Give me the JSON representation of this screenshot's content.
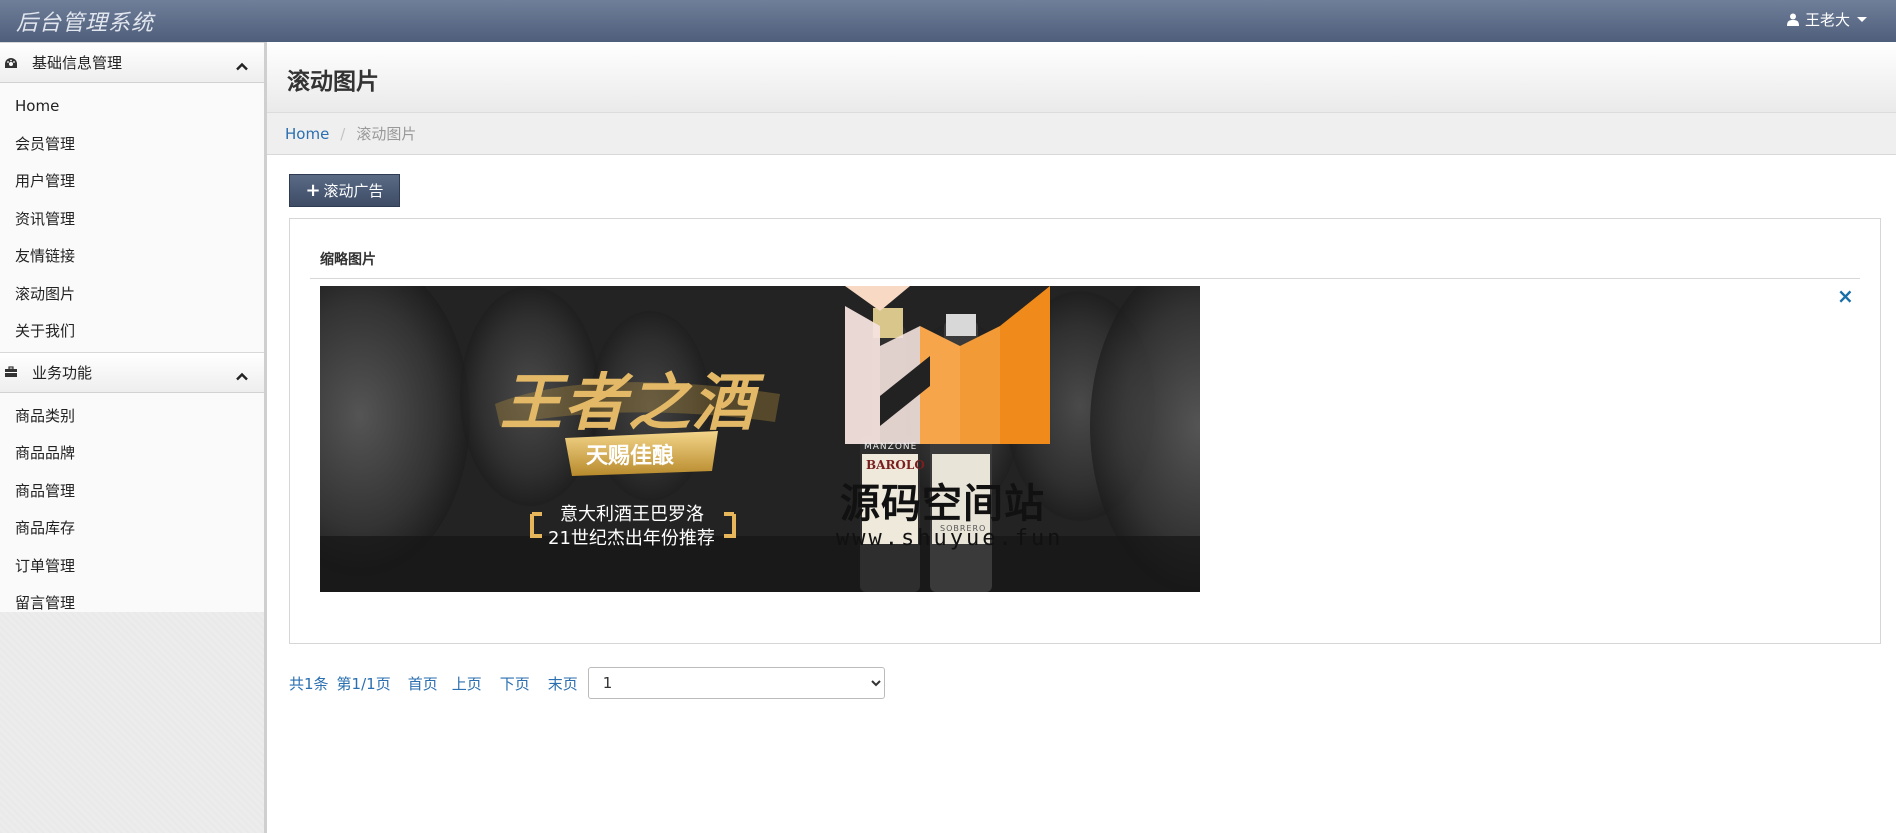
{
  "app": {
    "title": "后台管理系统"
  },
  "user": {
    "name": "王老大"
  },
  "sidebar": {
    "groups": [
      {
        "label": "基础信息管理",
        "items": [
          "Home",
          "会员管理",
          "用户管理",
          "资讯管理",
          "友情链接",
          "滚动图片",
          "关于我们"
        ]
      },
      {
        "label": "业务功能",
        "items": [
          "商品类别",
          "商品品牌",
          "商品管理",
          "商品库存",
          "订单管理",
          "留言管理"
        ]
      }
    ]
  },
  "page": {
    "title": "滚动图片"
  },
  "breadcrumb": {
    "home": "Home",
    "current": "滚动图片"
  },
  "toolbar": {
    "add_label": "滚动广告"
  },
  "table": {
    "column_header": "缩略图片",
    "delete_label": "×",
    "banner": {
      "headline": "王者之酒",
      "ribbon": "天赐佳酿",
      "line1": "意大利酒王巴罗洛",
      "line2": "21世纪杰出年份推荐",
      "bottle_label_1": "BAROLO",
      "bottle_label_2": "MANZONE",
      "bottle_label_3": "SOBRERO",
      "watermark_title": "源码空间站",
      "watermark_url": "www.shuyue.fun"
    }
  },
  "pagination": {
    "total": "共1条",
    "page_info": "第1/1页",
    "first": "首页",
    "prev": "上页",
    "next": "下页",
    "last": "末页",
    "selected_page": "1"
  },
  "colors": {
    "navbar": "#5b6b86",
    "link": "#2a6fb0",
    "button": "#4a5873"
  }
}
